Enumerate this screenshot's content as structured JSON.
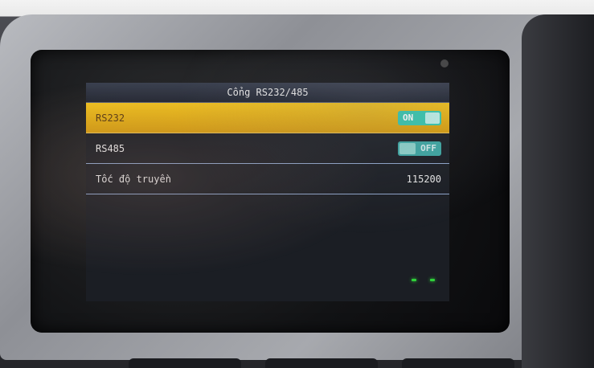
{
  "window": {
    "title": "Cổng RS232/485"
  },
  "settings": [
    {
      "label": "RS232",
      "toggle": "ON",
      "state": "on",
      "selected": true
    },
    {
      "label": "RS485",
      "toggle": "OFF",
      "state": "off",
      "selected": false
    },
    {
      "label": "Tốc độ truyền",
      "value": "115200"
    }
  ],
  "colors": {
    "selected_row": "#f1c21f",
    "toggle_on": "#39c8b0",
    "toggle_off": "#3ea8a4",
    "divider": "#8fa6cc"
  }
}
